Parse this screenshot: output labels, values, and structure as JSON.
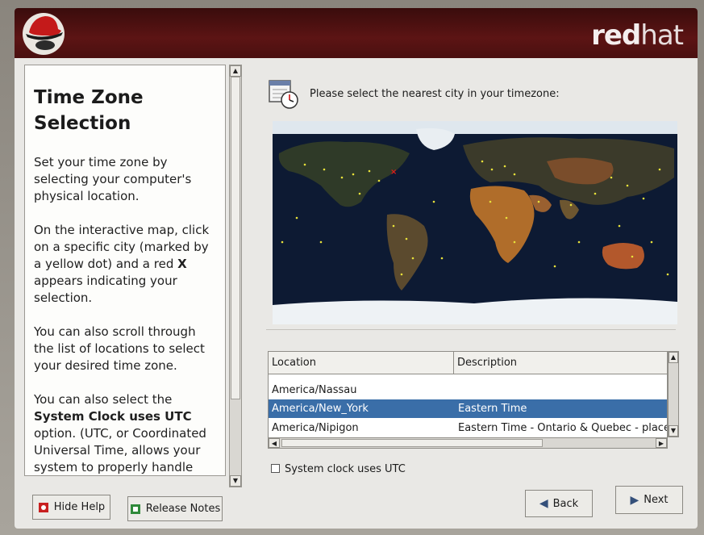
{
  "header": {
    "brand_bold": "red",
    "brand_light": "hat"
  },
  "help": {
    "title_line1": "Time Zone",
    "title_line2": "Selection",
    "p1": "Set your time zone by selecting your computer's physical location.",
    "p2_a": "On the interactive map, click on a specific city (marked by a yellow dot) and a red ",
    "p2_bold": "X",
    "p2_b": " appears indicating your selection.",
    "p3": "You can also scroll through the list of locations to select your desired time zone.",
    "p4_a": "You can also select the ",
    "p4_bold": "System Clock uses UTC",
    "p4_b": " option. (UTC, or Coordinated Universal Time, allows your system to properly handle"
  },
  "main": {
    "prompt": "Please select the nearest city in your timezone:",
    "table": {
      "headers": [
        "Location",
        "Description"
      ],
      "rows": [
        {
          "location": "America/Nassau",
          "description": ""
        },
        {
          "location": "America/New_York",
          "description": "Eastern Time"
        },
        {
          "location": "America/Nipigon",
          "description": "Eastern Time - Ontario & Quebec - places th"
        }
      ]
    },
    "utc_label": "System clock uses UTC"
  },
  "buttons": {
    "hide_help": "Hide Help",
    "release_notes": "Release Notes",
    "back": "Back",
    "next": "Next"
  },
  "colors": {
    "banner": "#4a1010",
    "selection": "#3a6ea8",
    "map_ocean": "#0d1a33"
  },
  "icons": [
    "redhat-logo-icon",
    "clock-calendar-icon",
    "hide-help-icon",
    "release-notes-icon",
    "back-arrow-icon",
    "next-arrow-icon"
  ]
}
